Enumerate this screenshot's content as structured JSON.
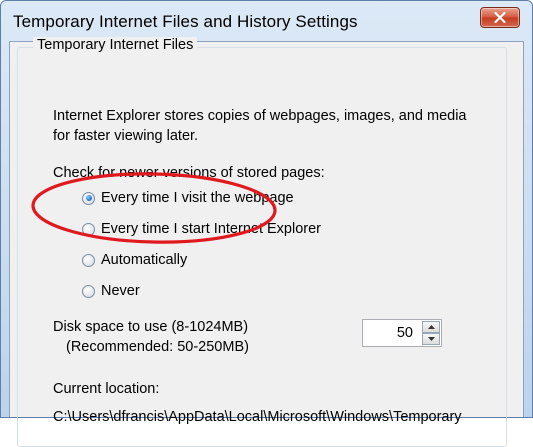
{
  "window": {
    "title": "Temporary Internet Files and History Settings"
  },
  "group": {
    "legend": "Temporary Internet Files",
    "description_line1": "Internet Explorer stores copies of webpages, images, and media",
    "description_line2": "for faster viewing later."
  },
  "check_newer": {
    "label": "Check for newer versions of stored pages:",
    "options": [
      {
        "label": "Every time I visit the webpage",
        "checked": true
      },
      {
        "label": "Every time I start Internet Explorer",
        "checked": false
      },
      {
        "label": "Automatically",
        "checked": false
      },
      {
        "label": "Never",
        "checked": false
      }
    ]
  },
  "disk_space": {
    "label_line1": "Disk space to use (8-1024MB)",
    "label_line2": "(Recommended: 50-250MB)",
    "value": "50"
  },
  "location": {
    "label": "Current location:",
    "path": "C:\\Users\\dfrancis\\AppData\\Local\\Microsoft\\Windows\\Temporary"
  },
  "colors": {
    "highlight_ellipse": "#e0191f",
    "radio_checked": "#1d6fc6"
  }
}
